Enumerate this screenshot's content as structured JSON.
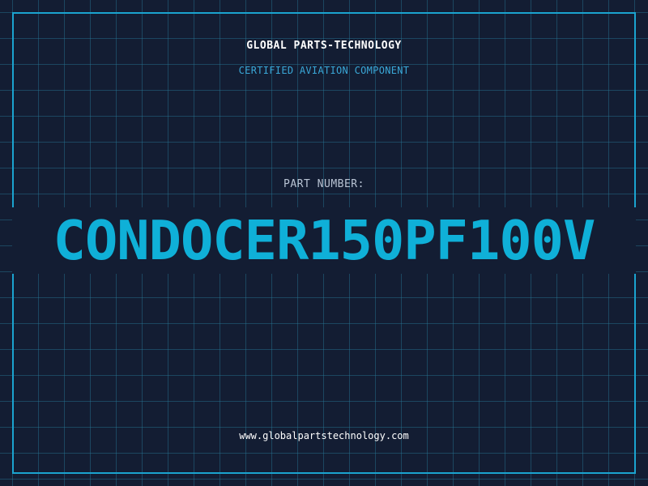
{
  "header": {
    "company": "GLOBAL PARTS-TECHNOLOGY",
    "subtitle": "CERTIFIED AVIATION COMPONENT"
  },
  "part": {
    "label": "PART NUMBER:",
    "number": "CONDOCER150PF100V"
  },
  "footer": {
    "website": "www.globalpartstechnology.com"
  },
  "colors": {
    "background": "#131d33",
    "accent": "#0fb0d8",
    "grid": "#287896"
  }
}
